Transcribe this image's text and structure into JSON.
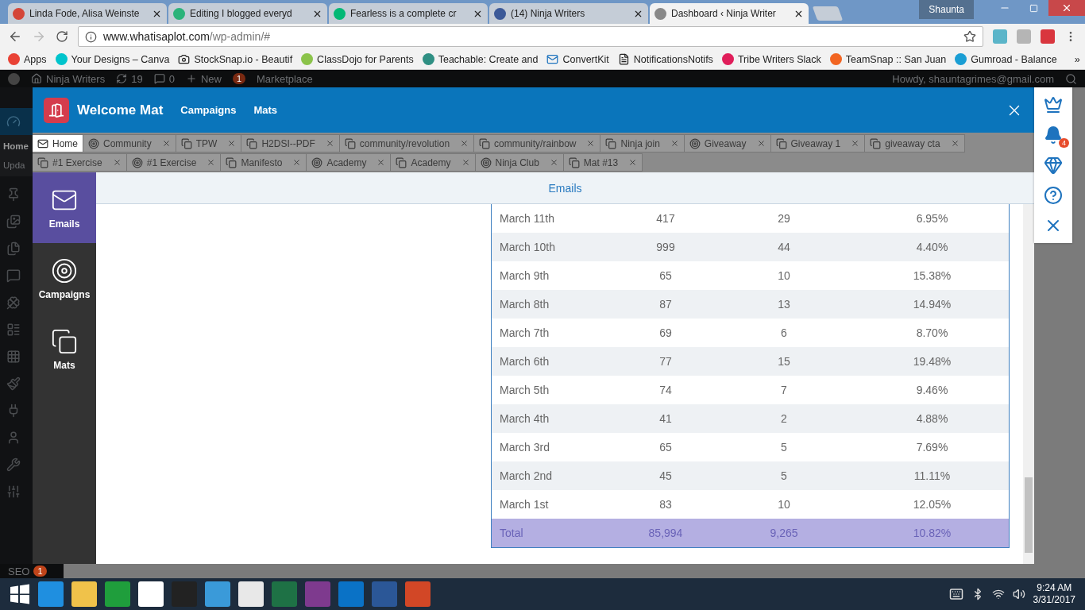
{
  "browser": {
    "tabs": [
      {
        "title": "Linda Fode, Alisa Weinste",
        "kind": "gmail",
        "selected": false
      },
      {
        "title": "Editing I blogged everyd",
        "kind": "medium-outline",
        "selected": false
      },
      {
        "title": "Fearless is a complete cr",
        "kind": "medium",
        "selected": false
      },
      {
        "title": "(14) Ninja Writers",
        "kind": "facebook",
        "selected": false
      },
      {
        "title": "Dashboard ‹ Ninja Writer",
        "kind": "wordpress",
        "selected": true
      }
    ],
    "profile": "Shaunta",
    "url_host": "www.whatisaplot.com",
    "url_path": "/wp-admin/#",
    "bookmarks": [
      {
        "label": "Apps",
        "kind": "apps"
      },
      {
        "label": "Your Designs – Canva",
        "kind": "canva"
      },
      {
        "label": "StockSnap.io - Beautif",
        "kind": "camera"
      },
      {
        "label": "ClassDojo for Parents",
        "kind": "dojo"
      },
      {
        "label": "Teachable: Create and",
        "kind": "teachable"
      },
      {
        "label": "ConvertKit",
        "kind": "mail"
      },
      {
        "label": "NotificationsNotifs",
        "kind": "page"
      },
      {
        "label": "Tribe Writers Slack",
        "kind": "slack"
      },
      {
        "label": "TeamSnap :: San Juan",
        "kind": "teamsnap"
      },
      {
        "label": "Gumroad - Balance",
        "kind": "gumroad"
      }
    ],
    "more": "»"
  },
  "wp_admin_bar": {
    "site": "Ninja Writers",
    "updates": "19",
    "comments": "0",
    "new": "New",
    "yoast_badge": "1",
    "marketplace": "Marketplace",
    "howdy": "Howdy, shauntagrimes@gmail.com"
  },
  "wp_sidebar": {
    "home": "Home",
    "updates": "Upda",
    "seo": "SEO",
    "seo_badge": "1"
  },
  "modal": {
    "title": "Welcome Mat",
    "nav": [
      "Campaigns",
      "Mats"
    ],
    "tab_rows": [
      [
        {
          "label": "Home",
          "kind": "envelope",
          "selected": true,
          "closable": false
        },
        {
          "label": "Community",
          "kind": "target",
          "selected": false,
          "closable": true
        },
        {
          "label": "TPW",
          "kind": "mat",
          "selected": false,
          "closable": true
        },
        {
          "label": "H2DSI--PDF",
          "kind": "mat",
          "selected": false,
          "closable": true
        },
        {
          "label": "community/revolution",
          "kind": "mat",
          "selected": false,
          "closable": true
        },
        {
          "label": "community/rainbow",
          "kind": "mat",
          "selected": false,
          "closable": true
        },
        {
          "label": "Ninja join",
          "kind": "mat",
          "selected": false,
          "closable": true
        },
        {
          "label": "Giveaway",
          "kind": "target",
          "selected": false,
          "closable": true
        },
        {
          "label": "Giveaway 1",
          "kind": "mat",
          "selected": false,
          "closable": true
        },
        {
          "label": "giveaway cta",
          "kind": "mat",
          "selected": false,
          "closable": true
        }
      ],
      [
        {
          "label": "#1 Exercise",
          "kind": "mat",
          "selected": false,
          "closable": true
        },
        {
          "label": "#1 Exercise",
          "kind": "target",
          "selected": false,
          "closable": true
        },
        {
          "label": "Manifesto",
          "kind": "mat",
          "selected": false,
          "closable": true
        },
        {
          "label": "Academy",
          "kind": "target",
          "selected": false,
          "closable": true
        },
        {
          "label": "Academy",
          "kind": "mat",
          "selected": false,
          "closable": true
        },
        {
          "label": "Ninja Club",
          "kind": "target",
          "selected": false,
          "closable": true
        },
        {
          "label": "Mat #13",
          "kind": "mat",
          "selected": false,
          "closable": true
        }
      ]
    ],
    "side_nav": [
      {
        "label": "Emails",
        "kind": "envelope",
        "selected": true
      },
      {
        "label": "Campaigns",
        "kind": "target",
        "selected": false
      },
      {
        "label": "Mats",
        "kind": "mat",
        "selected": false
      }
    ],
    "section_title": "Emails",
    "table": {
      "rows": [
        [
          "March 11th",
          "417",
          "29",
          "6.95%"
        ],
        [
          "March 10th",
          "999",
          "44",
          "4.40%"
        ],
        [
          "March 9th",
          "65",
          "10",
          "15.38%"
        ],
        [
          "March 8th",
          "87",
          "13",
          "14.94%"
        ],
        [
          "March 7th",
          "69",
          "6",
          "8.70%"
        ],
        [
          "March 6th",
          "77",
          "15",
          "19.48%"
        ],
        [
          "March 5th",
          "74",
          "7",
          "9.46%"
        ],
        [
          "March 4th",
          "41",
          "2",
          "4.88%"
        ],
        [
          "March 3rd",
          "65",
          "5",
          "7.69%"
        ],
        [
          "March 2nd",
          "45",
          "5",
          "11.11%"
        ],
        [
          "March 1st",
          "83",
          "10",
          "12.05%"
        ]
      ],
      "total": [
        "Total",
        "85,994",
        "9,265",
        "10.82%"
      ]
    }
  },
  "floating_panel": {
    "notification_badge": "4"
  },
  "taskbar": {
    "time": "9:24 AM",
    "date": "3/31/2017"
  }
}
